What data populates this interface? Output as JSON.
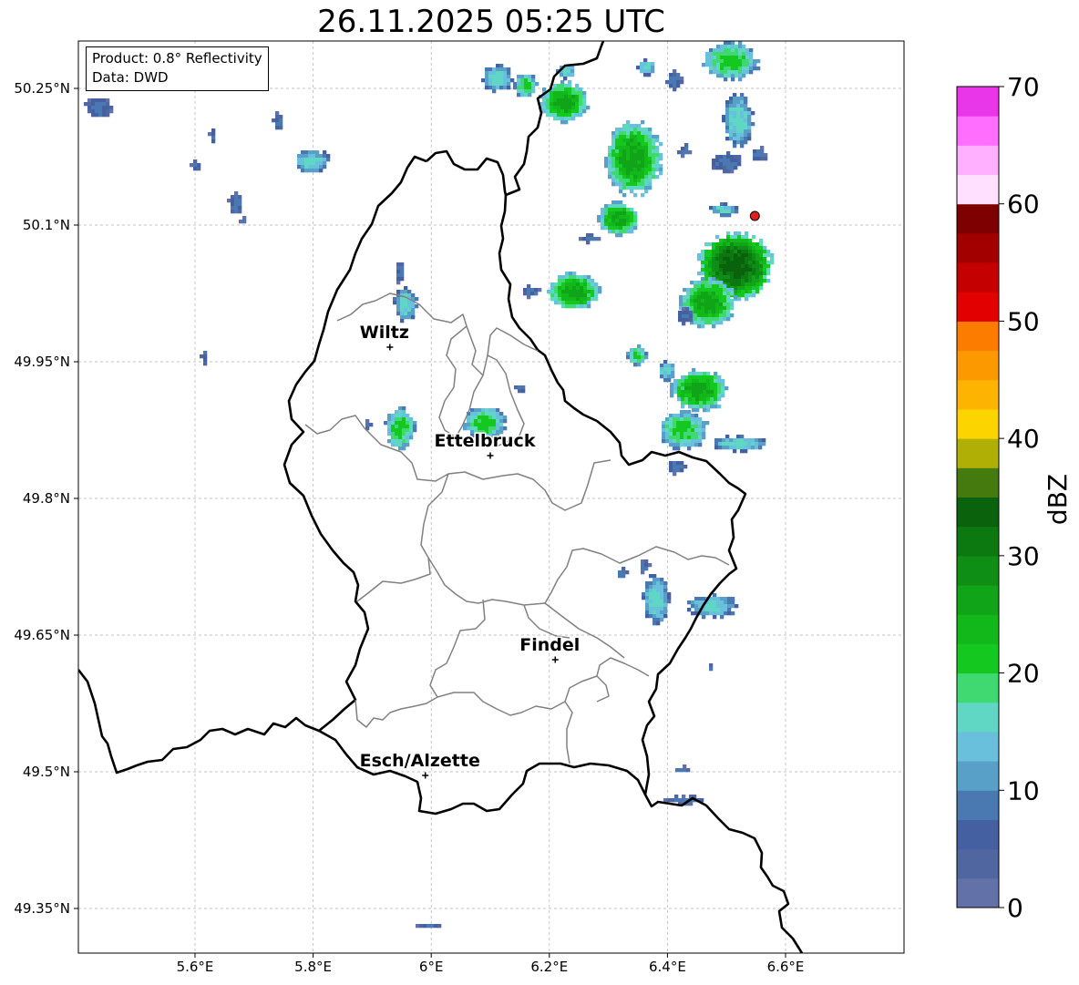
{
  "title": "26.11.2025 05:25 UTC",
  "info": {
    "product": "Product: 0.8° Reflectivity",
    "data": "Data: DWD"
  },
  "map": {
    "lon_range": [
      5.4,
      6.8
    ],
    "lat_range": [
      49.3,
      50.3
    ],
    "xticks": [
      {
        "lon": 5.6,
        "label": "5.6°E"
      },
      {
        "lon": 5.8,
        "label": "5.8°E"
      },
      {
        "lon": 6.0,
        "label": "6°E"
      },
      {
        "lon": 6.2,
        "label": "6.2°E"
      },
      {
        "lon": 6.4,
        "label": "6.4°E"
      },
      {
        "lon": 6.6,
        "label": "6.6°E"
      }
    ],
    "yticks": [
      {
        "lat": 49.35,
        "label": "49.35°N"
      },
      {
        "lat": 49.5,
        "label": "49.5°N"
      },
      {
        "lat": 49.65,
        "label": "49.65°N"
      },
      {
        "lat": 49.8,
        "label": "49.8°N"
      },
      {
        "lat": 49.95,
        "label": "49.95°N"
      },
      {
        "lat": 50.1,
        "label": "50.1°N"
      },
      {
        "lat": 50.25,
        "label": "50.25°N"
      }
    ],
    "cities": [
      {
        "name": "Wiltz",
        "lon": 5.93,
        "lat": 49.966
      },
      {
        "name": "Ettelbruck",
        "lon": 6.1,
        "lat": 49.847
      },
      {
        "name": "Findel",
        "lon": 6.21,
        "lat": 49.623
      },
      {
        "name": "Esch/Alzette",
        "lon": 5.99,
        "lat": 49.496
      }
    ],
    "radar_site": {
      "lon": 6.548,
      "lat": 50.11
    }
  },
  "colorbar": {
    "label": "dBZ",
    "ticks": [
      "0",
      "10",
      "20",
      "30",
      "40",
      "50",
      "60",
      "70"
    ],
    "colors": [
      "#6272a8",
      "#5066a0",
      "#4560a0",
      "#4a78b0",
      "#58a0c8",
      "#68c0dc",
      "#60d6c4",
      "#40d870",
      "#14c820",
      "#12b81a",
      "#10a418",
      "#0e8e14",
      "#0c7810",
      "#0a620c",
      "#457a0e",
      "#afaf05",
      "#fcd400",
      "#fcb400",
      "#fc9800",
      "#fc7c00",
      "#e20000",
      "#c40000",
      "#a20000",
      "#7e0000",
      "#ffe0ff",
      "#ffb0ff",
      "#ff6eff",
      "#e836e8"
    ]
  }
}
